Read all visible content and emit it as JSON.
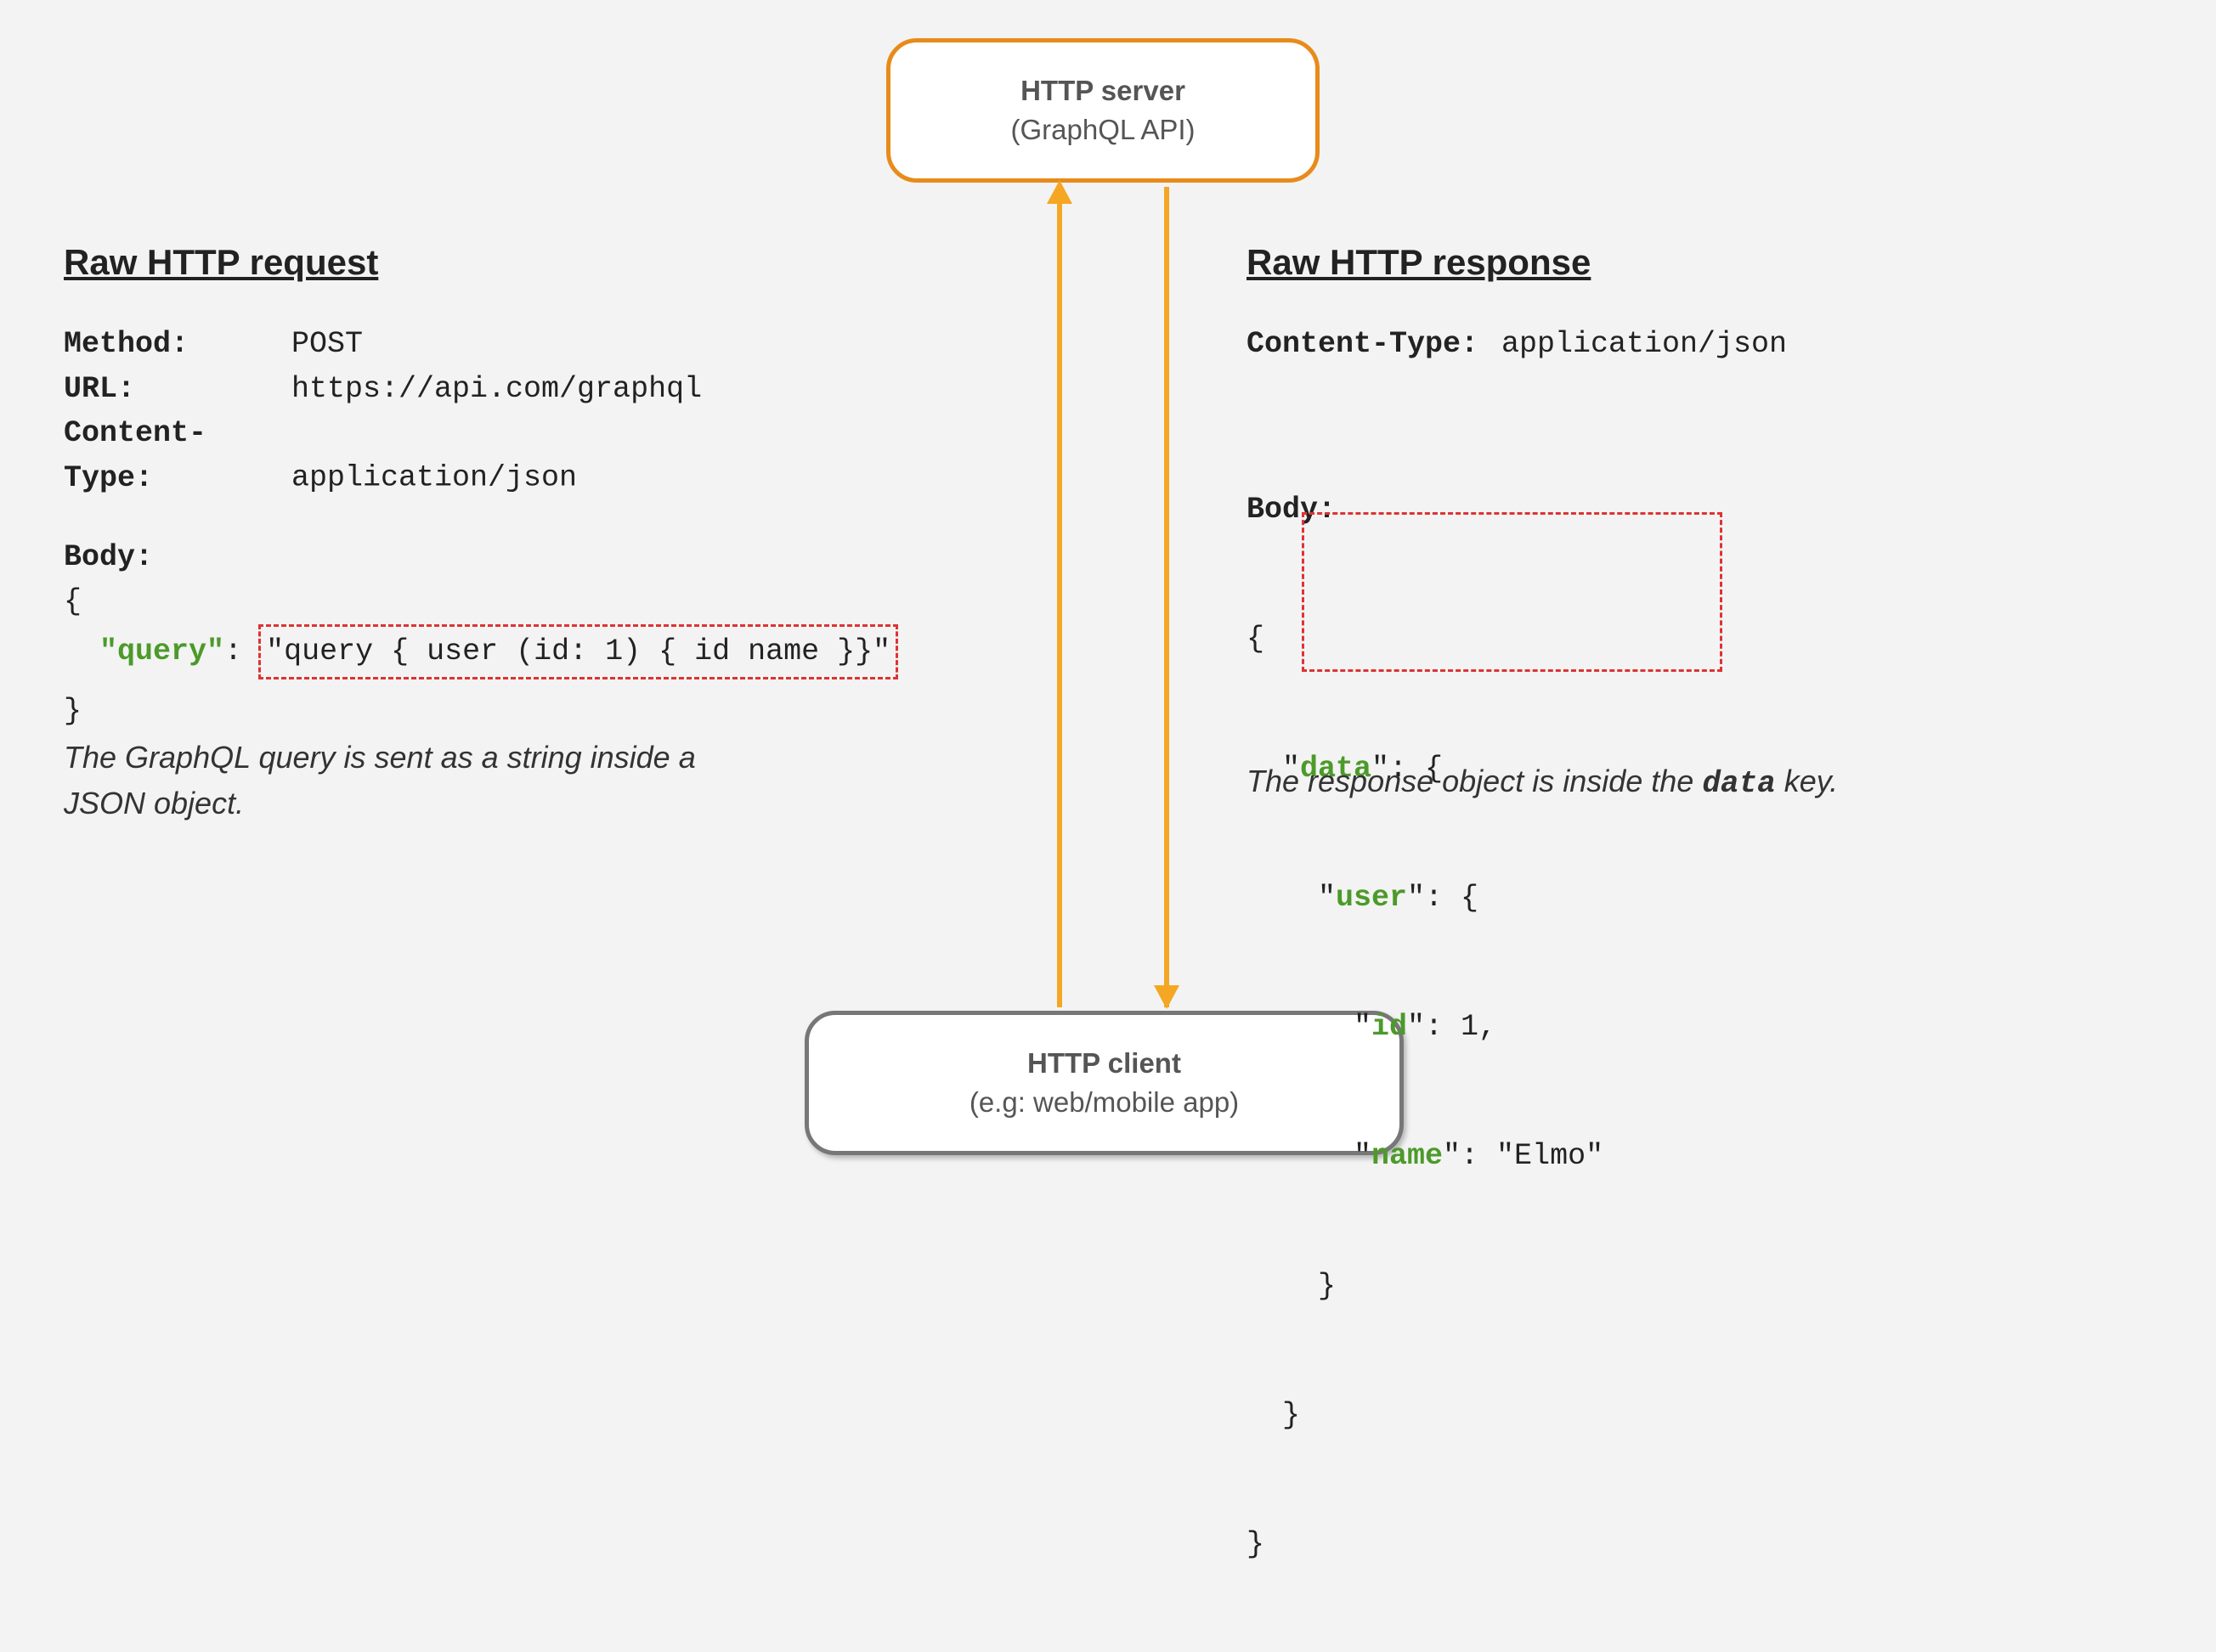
{
  "server": {
    "title": "HTTP server",
    "subtitle": "(GraphQL API)"
  },
  "client": {
    "title": "HTTP client",
    "subtitle": "(e.g: web/mobile app)"
  },
  "request": {
    "heading": "Raw HTTP request",
    "method_label": "Method:",
    "method_value": "POST",
    "url_label": "URL:",
    "url_value": "https://api.com/graphql",
    "ctype_label": "Content-Type:",
    "ctype_value": "application/json",
    "body_label": "Body:",
    "brace_open": "{",
    "query_key": "\"query\"",
    "colon_space": ": ",
    "query_value": "\"query { user (id: 1) { id name }}\"",
    "brace_close": "}",
    "caption": "The GraphQL query is sent as a string inside a JSON object."
  },
  "response": {
    "heading": "Raw HTTP response",
    "ctype_label": "Content-Type:",
    "ctype_value": "application/json",
    "body_label": "Body:",
    "l1": "{",
    "l2_pre": "  \"",
    "l2_key": "data",
    "l2_post": "\": {",
    "l3_pre": "    \"",
    "l3_key": "user",
    "l3_post": "\": {",
    "l4_pre": "      \"",
    "l4_key": "id",
    "l4_post": "\": 1,",
    "l5_pre": "      \"",
    "l5_key": "name",
    "l5_post": "\": \"Elmo\"",
    "l6": "    }",
    "l7": "  }",
    "l8": "}",
    "caption_a": "The response object is inside the ",
    "caption_key": "data",
    "caption_b": " key."
  }
}
